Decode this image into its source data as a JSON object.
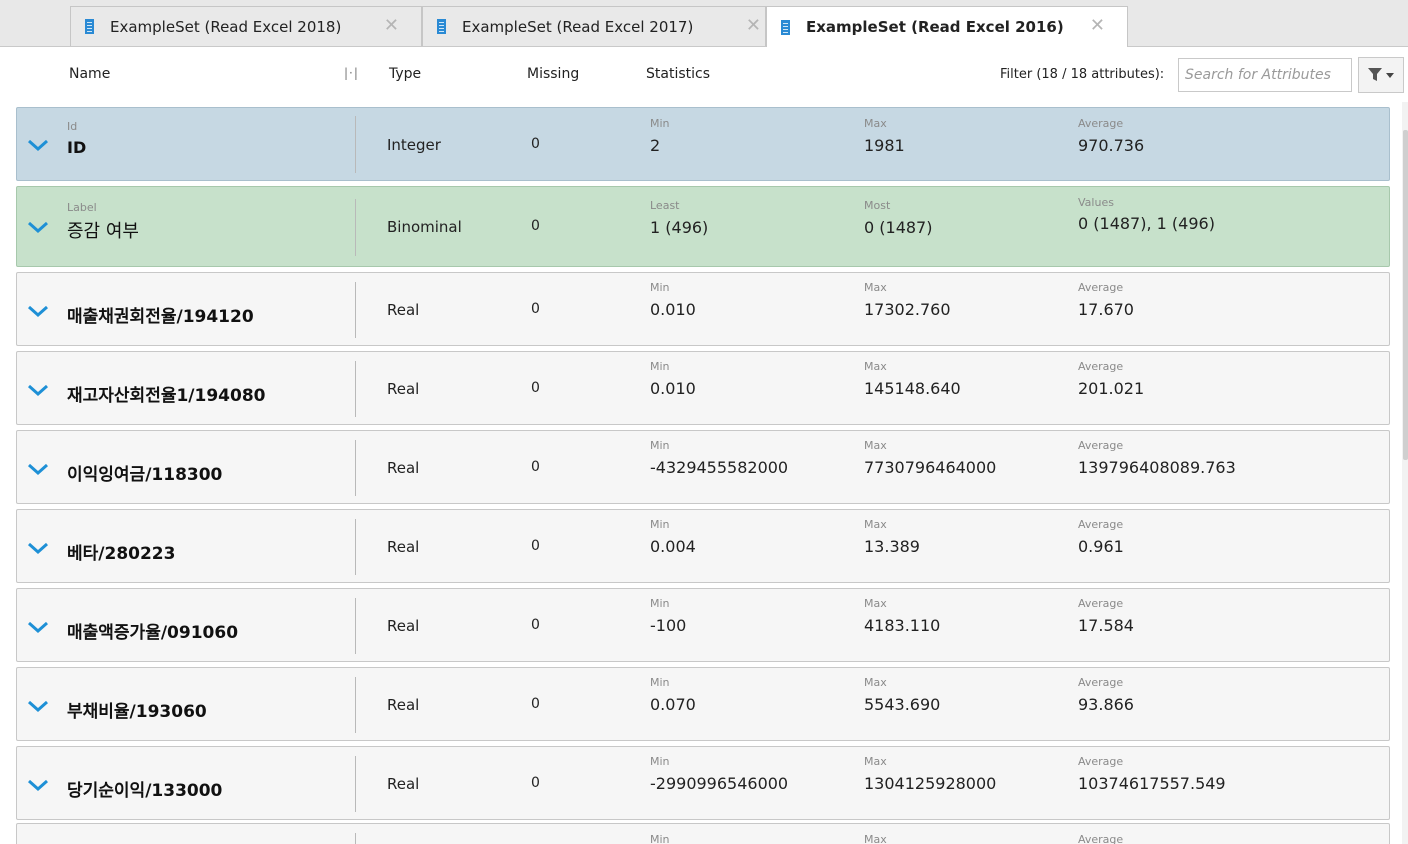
{
  "tabs": [
    {
      "label": "ExampleSet (Read Excel 2018)",
      "close": "✕",
      "active": false
    },
    {
      "label": "ExampleSet (Read Excel 2017)",
      "close": "✕",
      "active": false
    },
    {
      "label": "ExampleSet (Read Excel 2016)",
      "close": "✕",
      "active": true
    }
  ],
  "header": {
    "name": "Name",
    "type": "Type",
    "missing": "Missing",
    "statistics": "Statistics",
    "filter_label": "Filter (18 / 18 attributes):",
    "search_placeholder": "Search for Attributes"
  },
  "colors": {
    "accent": "#2a8ad4",
    "id_row": "#c6d8e3",
    "label_row": "#c7e1cb",
    "row": "#f6f6f6"
  },
  "rows": [
    {
      "role": "Id",
      "name": "ID",
      "type": "Integer",
      "missing": "0",
      "s1_label": "Min",
      "s1": "2",
      "s2_label": "Max",
      "s2": "1981",
      "s3_label": "Average",
      "s3": "970.736"
    },
    {
      "role": "Label",
      "name": "증감 여부",
      "type": "Binominal",
      "missing": "0",
      "s1_label": "Least",
      "s1": "1 (496)",
      "s2_label": "Most",
      "s2": "0 (1487)",
      "s3_label": "Values",
      "s3": "0 (1487), 1 (496)"
    },
    {
      "role": "",
      "name": "매출채권회전율/194120",
      "type": "Real",
      "missing": "0",
      "s1_label": "Min",
      "s1": "0.010",
      "s2_label": "Max",
      "s2": "17302.760",
      "s3_label": "Average",
      "s3": "17.670"
    },
    {
      "role": "",
      "name": "재고자산회전율1/194080",
      "type": "Real",
      "missing": "0",
      "s1_label": "Min",
      "s1": "0.010",
      "s2_label": "Max",
      "s2": "145148.640",
      "s3_label": "Average",
      "s3": "201.021"
    },
    {
      "role": "",
      "name": "이익잉여금/118300",
      "type": "Real",
      "missing": "0",
      "s1_label": "Min",
      "s1": "-4329455582000",
      "s2_label": "Max",
      "s2": "7730796464000",
      "s3_label": "Average",
      "s3": "139796408089.763"
    },
    {
      "role": "",
      "name": "베타/280223",
      "type": "Real",
      "missing": "0",
      "s1_label": "Min",
      "s1": "0.004",
      "s2_label": "Max",
      "s2": "13.389",
      "s3_label": "Average",
      "s3": "0.961"
    },
    {
      "role": "",
      "name": "매출액증가율/091060",
      "type": "Real",
      "missing": "0",
      "s1_label": "Min",
      "s1": "-100",
      "s2_label": "Max",
      "s2": "4183.110",
      "s3_label": "Average",
      "s3": "17.584"
    },
    {
      "role": "",
      "name": "부채비율/193060",
      "type": "Real",
      "missing": "0",
      "s1_label": "Min",
      "s1": "0.070",
      "s2_label": "Max",
      "s2": "5543.690",
      "s3_label": "Average",
      "s3": "93.866"
    },
    {
      "role": "",
      "name": "당기순이익/133000",
      "type": "Real",
      "missing": "0",
      "s1_label": "Min",
      "s1": "-2990996546000",
      "s2_label": "Max",
      "s2": "1304125928000",
      "s3_label": "Average",
      "s3": "10374617557.549"
    },
    {
      "role": "",
      "name": "",
      "type": "",
      "missing": "",
      "s1_label": "Min",
      "s1": "",
      "s2_label": "Max",
      "s2": "",
      "s3_label": "Average",
      "s3": ""
    }
  ]
}
